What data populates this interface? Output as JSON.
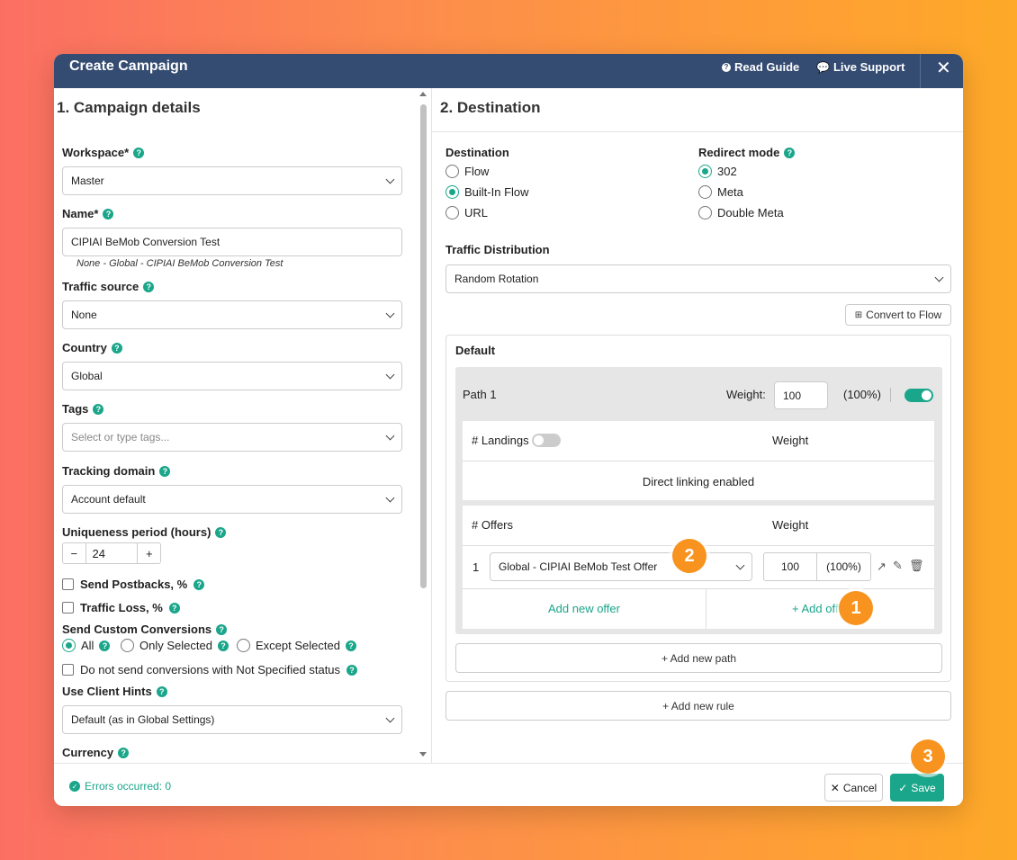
{
  "header": {
    "title": "Create Campaign",
    "read_guide": "Read Guide",
    "live_support": "Live Support",
    "close": "✕"
  },
  "left": {
    "title": "1. Campaign details",
    "workspace": {
      "label": "Workspace*",
      "value": "Master"
    },
    "name": {
      "label": "Name*",
      "value": "CIPIAI BeMob Conversion Test",
      "hint": "None - Global - CIPIAI BeMob Conversion Test"
    },
    "traffic_source": {
      "label": "Traffic source",
      "value": "None"
    },
    "country": {
      "label": "Country",
      "value": "Global"
    },
    "tags": {
      "label": "Tags",
      "placeholder": "Select or type tags..."
    },
    "tracking_domain": {
      "label": "Tracking domain",
      "value": "Account default"
    },
    "uniqueness": {
      "label": "Uniqueness period (hours)",
      "minus": "−",
      "value": "24",
      "plus": "+"
    },
    "send_postbacks": "Send Postbacks, %",
    "traffic_loss": "Traffic Loss, %",
    "custom_conversions": {
      "label": "Send Custom Conversions",
      "all": "All",
      "only_selected": "Only Selected",
      "except_selected": "Except Selected"
    },
    "not_specified": "Do not send conversions with Not Specified status",
    "client_hints": {
      "label": "Use Client Hints",
      "value": "Default (as in Global Settings)"
    },
    "currency": {
      "label": "Currency"
    }
  },
  "right": {
    "title": "2. Destination",
    "destination": {
      "label": "Destination",
      "flow": "Flow",
      "built_in": "Built-In Flow",
      "url": "URL"
    },
    "redirect": {
      "label": "Redirect mode",
      "r302": "302",
      "meta": "Meta",
      "double_meta": "Double Meta"
    },
    "traffic_distribution": {
      "label": "Traffic Distribution",
      "value": "Random Rotation"
    },
    "convert_to_flow": "Convert to Flow",
    "default_label": "Default",
    "path": {
      "name": "Path 1",
      "weight_label": "Weight:",
      "weight_value": "100",
      "weight_pct": "(100%)",
      "landings_header": "# Landings",
      "weight_header": "Weight",
      "direct_linking": "Direct linking enabled",
      "offers_header": "# Offers",
      "offer_index": "1",
      "offer_value": "Global - CIPIAI BeMob Test Offer",
      "offer_weight": "100",
      "offer_pct": "(100%)",
      "add_new_offer": "Add new offer",
      "add_offer": "+ Add off"
    },
    "add_new_path": "+ Add new path",
    "add_new_rule": "+ Add new rule"
  },
  "footer": {
    "errors": "Errors occurred: 0",
    "cancel": "Cancel",
    "save": "Save"
  },
  "badges": [
    "1",
    "2",
    "3"
  ],
  "colors": {
    "header": "#344b72",
    "accent": "#1aa68a",
    "badge": "#f7931e"
  }
}
